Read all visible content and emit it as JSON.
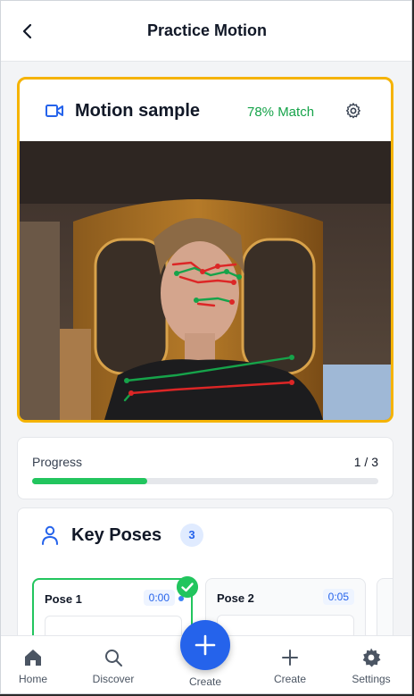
{
  "header": {
    "title": "Practice Motion",
    "back_icon": "chevron-left-icon"
  },
  "motion_sample": {
    "title": "Motion sample",
    "match_label": "78% Match",
    "icon": "video-camera-icon",
    "settings_icon": "gear-icon",
    "accent_color": "#f5b301",
    "match_color": "#16a34a"
  },
  "progress": {
    "label": "Progress",
    "count": "1 / 3",
    "fraction": 0.333
  },
  "key_poses": {
    "title": "Key Poses",
    "count": "3",
    "items": [
      {
        "name": "Pose 1",
        "time": "0:00",
        "completed": true
      },
      {
        "name": "Pose 2",
        "time": "0:05",
        "completed": false
      }
    ]
  },
  "nav": {
    "items": [
      {
        "label": "Home",
        "icon": "home-icon"
      },
      {
        "label": "Discover",
        "icon": "search-icon"
      },
      {
        "label": "Create",
        "icon": "plus-icon"
      },
      {
        "label": "Settings",
        "icon": "gear-icon"
      }
    ],
    "fab_label": "Create",
    "fab_color": "#2563eb"
  }
}
